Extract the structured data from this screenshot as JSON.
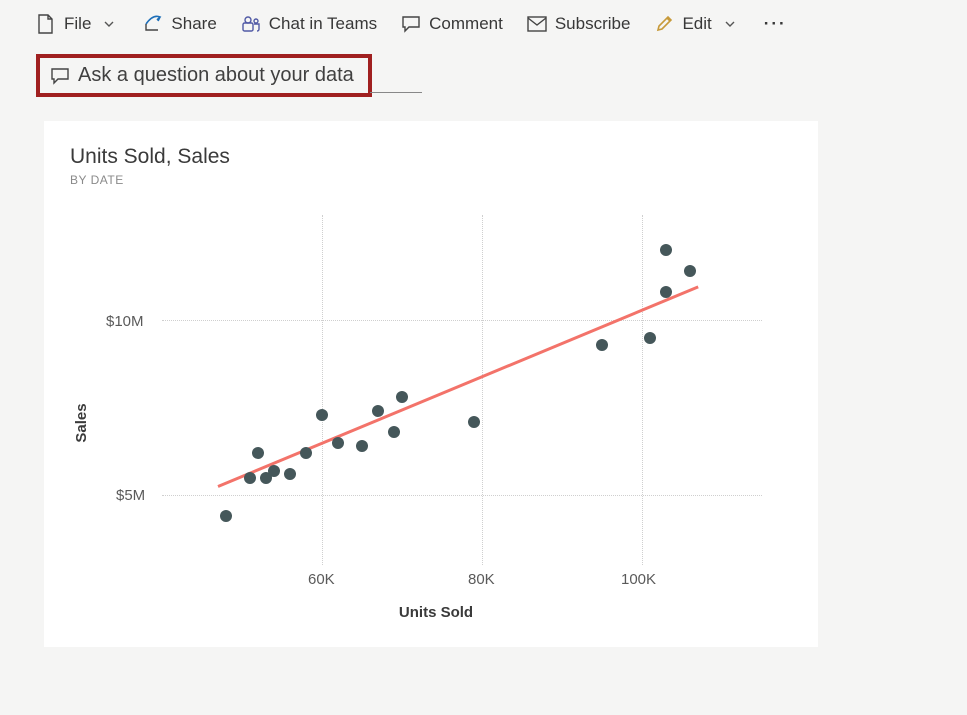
{
  "toolbar": {
    "file_label": "File",
    "share_label": "Share",
    "chat_label": "Chat in Teams",
    "comment_label": "Comment",
    "subscribe_label": "Subscribe",
    "edit_label": "Edit"
  },
  "qa": {
    "placeholder": "Ask a question about your data"
  },
  "chart": {
    "title": "Units Sold, Sales",
    "subtitle": "BY DATE",
    "ylabel": "Sales",
    "xlabel": "Units Sold",
    "y_ticks": [
      "$10M",
      "$5M"
    ],
    "x_ticks": [
      "60K",
      "80K",
      "100K"
    ]
  },
  "chart_data": {
    "type": "scatter",
    "x": [
      48000,
      51000,
      52000,
      53000,
      54000,
      56000,
      58000,
      60000,
      62000,
      65000,
      67000,
      69000,
      70000,
      79000,
      95000,
      101000,
      103000,
      103000,
      106000
    ],
    "y": [
      4400000,
      5500000,
      6200000,
      5500000,
      5700000,
      5600000,
      6200000,
      7300000,
      6500000,
      6400000,
      7400000,
      6800000,
      7800000,
      7100000,
      9300000,
      9500000,
      10800000,
      12000000,
      11400000
    ],
    "title": "Units Sold, Sales",
    "xlabel": "Units Sold",
    "ylabel": "Sales",
    "xlim": [
      40000,
      115000
    ],
    "ylim": [
      3000000,
      13000000
    ],
    "trendline": {
      "x0": 47000,
      "y0": 5300000,
      "x1": 107000,
      "y1": 11000000
    },
    "grid": true
  }
}
